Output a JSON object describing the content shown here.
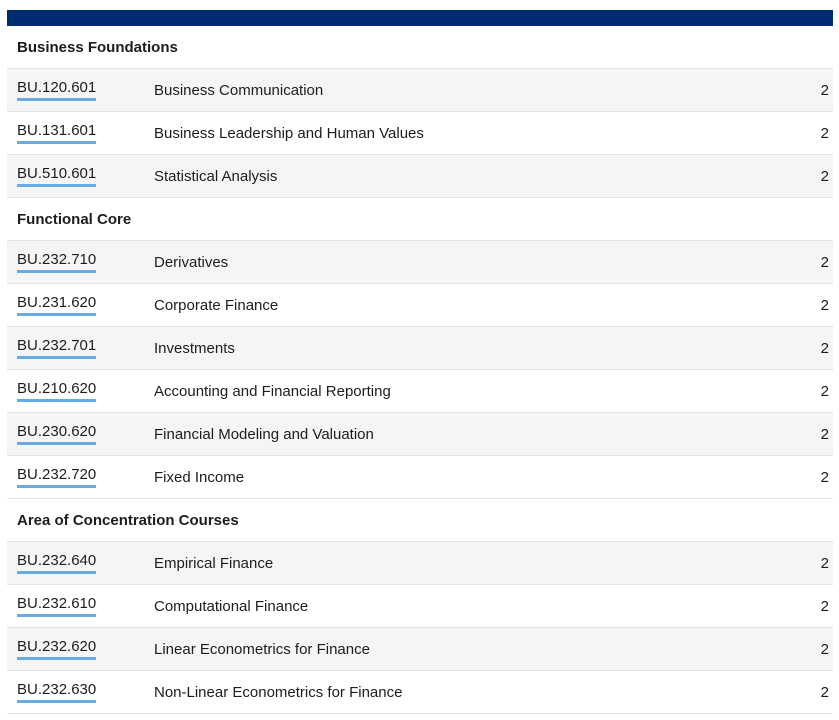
{
  "sections": [
    {
      "title": "Business Foundations",
      "courses": [
        {
          "code": "BU.120.601",
          "title": "Business Communication",
          "hours": "2"
        },
        {
          "code": "BU.131.601",
          "title": "Business Leadership and Human Values",
          "hours": "2"
        },
        {
          "code": "BU.510.601",
          "title": "Statistical Analysis",
          "hours": "2"
        }
      ]
    },
    {
      "title": "Functional Core",
      "courses": [
        {
          "code": "BU.232.710",
          "title": "Derivatives",
          "hours": "2"
        },
        {
          "code": "BU.231.620",
          "title": "Corporate Finance",
          "hours": "2"
        },
        {
          "code": "BU.232.701",
          "title": "Investments",
          "hours": "2"
        },
        {
          "code": "BU.210.620",
          "title": "Accounting and Financial Reporting",
          "hours": "2"
        },
        {
          "code": "BU.230.620",
          "title": "Financial Modeling and Valuation",
          "hours": "2"
        },
        {
          "code": "BU.232.720",
          "title": "Fixed Income",
          "hours": "2"
        }
      ]
    },
    {
      "title": "Area of Concentration Courses",
      "courses": [
        {
          "code": "BU.232.640",
          "title": "Empirical Finance",
          "hours": "2"
        },
        {
          "code": "BU.232.610",
          "title": "Computational Finance",
          "hours": "2"
        },
        {
          "code": "BU.232.620",
          "title": "Linear Econometrics for Finance",
          "hours": "2"
        },
        {
          "code": "BU.232.630",
          "title": "Non-Linear Econometrics for Finance",
          "hours": "2"
        }
      ]
    }
  ],
  "colors": {
    "top_bar": "#002d72",
    "link_underline": "#68ace5",
    "stripe": "#f5f5f5"
  }
}
